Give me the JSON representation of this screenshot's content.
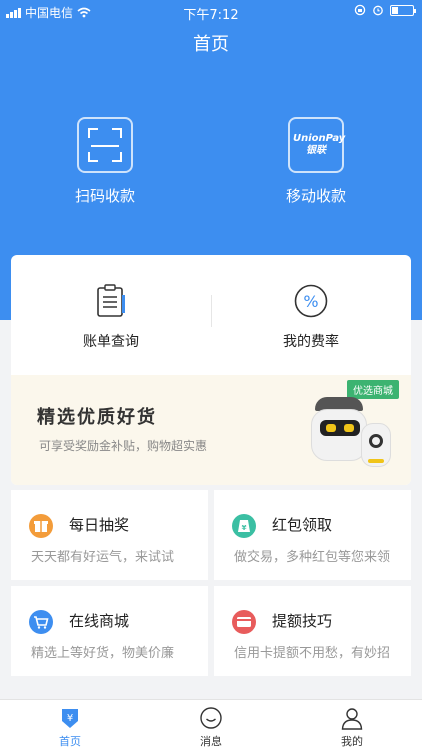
{
  "status_bar": {
    "carrier": "中国电信",
    "time": "下午7:12"
  },
  "header": {
    "title": "首页"
  },
  "hero_actions": [
    {
      "label": "扫码收款",
      "icon": "scan-qr-icon"
    },
    {
      "label": "移动收款",
      "icon": "unionpay-icon",
      "logo_text": "UnionPay 银联"
    }
  ],
  "tools": [
    {
      "label": "账单查询",
      "icon": "bill-clipboard-icon"
    },
    {
      "label": "我的费率",
      "icon": "percent-icon"
    }
  ],
  "banner": {
    "headline": "精选优质好货",
    "subtext": "可享受奖励金补贴，购物超实惠",
    "tag": "优选商城"
  },
  "features": [
    {
      "title": "每日抽奖",
      "desc": "天天都有好运气，来试试",
      "icon": "gift-icon",
      "color": "#f39c3a"
    },
    {
      "title": "红包领取",
      "desc": "做交易，多种红包等您来领",
      "icon": "red-packet-icon",
      "color": "#3bbfa3"
    },
    {
      "title": "在线商城",
      "desc": "精选上等好货，物美价廉",
      "icon": "shopping-cart-icon",
      "color": "#3d8ef0"
    },
    {
      "title": "提额技巧",
      "desc": "信用卡提额不用愁，有妙招",
      "icon": "credit-card-icon",
      "color": "#e85c5c"
    }
  ],
  "tabbar": [
    {
      "label": "首页",
      "icon": "home-yuan-icon",
      "active": true
    },
    {
      "label": "消息",
      "icon": "message-smile-icon",
      "active": false
    },
    {
      "label": "我的",
      "icon": "user-icon",
      "active": false
    }
  ],
  "colors": {
    "primary": "#3d8ef0",
    "banner_bg": "#fbf7ec",
    "tag": "#3cb371"
  }
}
